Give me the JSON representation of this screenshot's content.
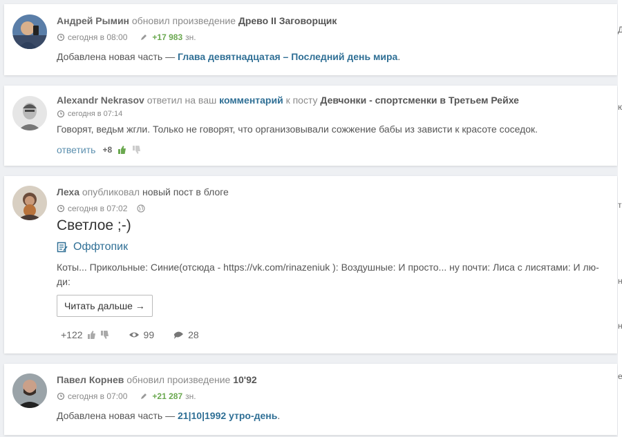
{
  "feed": [
    {
      "type": "work_update",
      "author": "Андрей Рымин",
      "action": "обновил произведение",
      "work": "Древо II Заговорщик",
      "time": "сегодня в 08:00",
      "chars": "+17 983",
      "chars_unit": "зн.",
      "text_prefix": "Добавлена новая часть —",
      "chapter": "Глава девятнадцатая – Последний день мира",
      "text_suffix": "."
    },
    {
      "type": "comment_reply",
      "author": "Alexandr Nekrasov",
      "action": "ответил на ваш",
      "link": "комментарий",
      "mid": "к посту",
      "post": "Девчонки - спортсменки в Третьем Рейхе",
      "time": "сегодня в 07:14",
      "text": "Говорят, ведьм жгли. Только не говорят, что организовывали сожжение бабы из зависти к красоте соседок.",
      "reply_label": "ответить",
      "score": "+8"
    },
    {
      "type": "blog_post",
      "author": "Леха",
      "action": "опубликовал",
      "tail": "новый пост в блоге",
      "time": "сегодня в 07:02",
      "title": "Светлое ;-)",
      "category": "Оффтопик",
      "excerpt": "Коты... Прикольные: Синие(отсюда - https://vk.com/rinazeniuk ): Воздушные: И просто... ну почти: Лиса с лисятами: И лю-ди:",
      "read_more": "Читать дальше →",
      "rating": "+122",
      "views": "99",
      "comments": "28"
    },
    {
      "type": "work_update",
      "author": "Павел Корнев",
      "action": "обновил произведение",
      "work": "10'92",
      "time": "сегодня в 07:00",
      "chars": "+21 287",
      "chars_unit": "зн.",
      "text_prefix": "Добавлена новая часть —",
      "chapter": "21|10|1992 утро-день",
      "text_suffix": "."
    }
  ],
  "right_fragments": [
    "Д",
    "ю",
    "т",
    "н",
    "н",
    "е"
  ],
  "colors": {
    "link": "#2f6f95",
    "green": "#6aa84f",
    "background": "#eef0f3"
  },
  "icons": [
    "clock-icon",
    "pencil-icon",
    "globe-icon",
    "category-icon",
    "thumb-up-icon",
    "thumb-down-icon",
    "eye-icon",
    "comment-icon"
  ]
}
